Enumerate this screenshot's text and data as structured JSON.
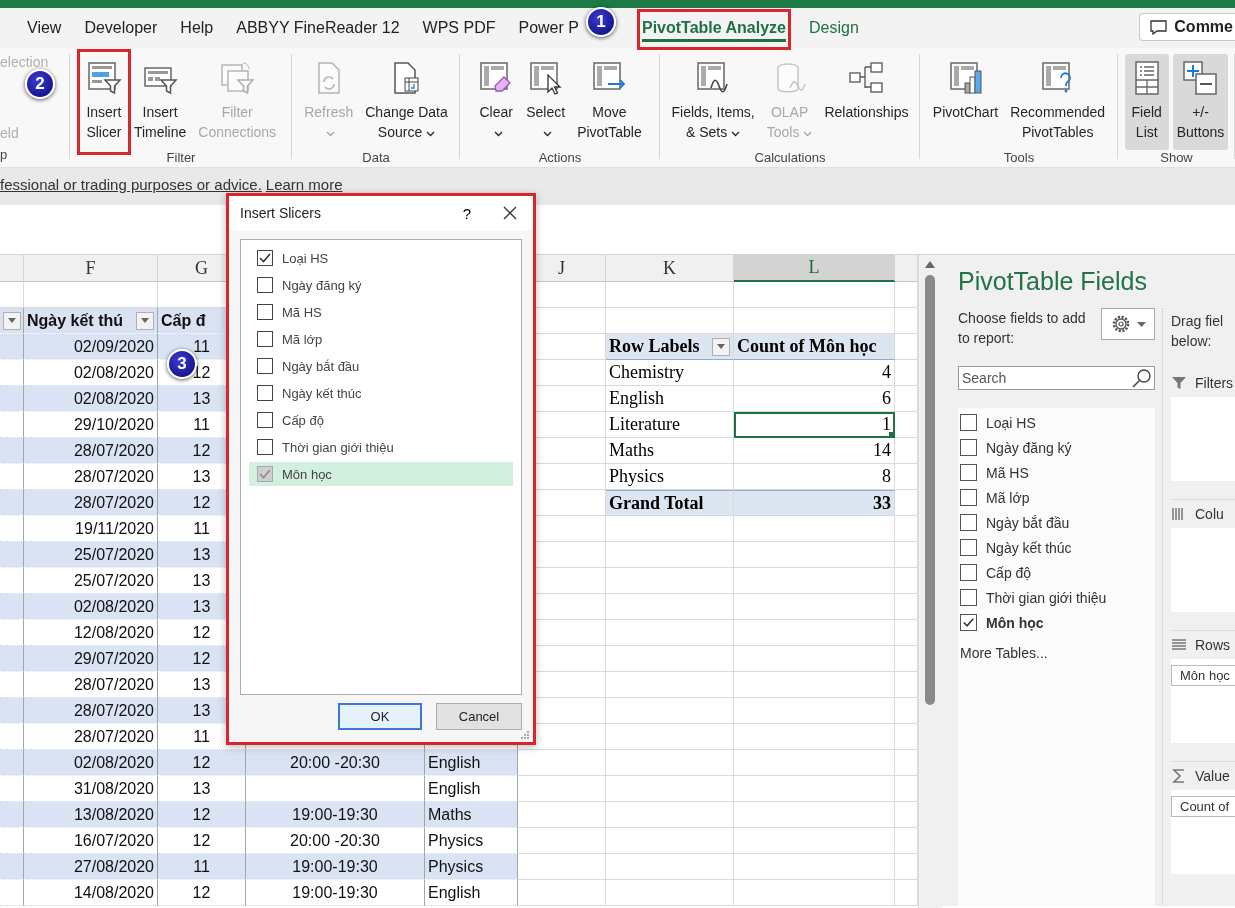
{
  "tabs": [
    {
      "label": "View",
      "selected": false,
      "contextual": false,
      "highlighted": false
    },
    {
      "label": "Developer",
      "selected": false,
      "contextual": false,
      "highlighted": false
    },
    {
      "label": "Help",
      "selected": false,
      "contextual": false,
      "highlighted": false
    },
    {
      "label": "ABBYY FineReader 12",
      "selected": false,
      "contextual": false,
      "highlighted": false
    },
    {
      "label": "WPS PDF",
      "selected": false,
      "contextual": false,
      "highlighted": false
    },
    {
      "label": "Power P",
      "selected": false,
      "contextual": false,
      "highlighted": false
    },
    {
      "label": "PivotTable Analyze",
      "selected": true,
      "contextual": true,
      "highlighted": true
    },
    {
      "label": "Design",
      "selected": false,
      "contextual": true,
      "highlighted": false
    }
  ],
  "comments_button": "Comme",
  "ribbon_groups": [
    {
      "label": "p",
      "buttons": [
        {
          "kind": "stub",
          "label": "election",
          "disabled": true
        },
        {
          "kind": "stub",
          "label": "eld",
          "disabled": true
        }
      ]
    },
    {
      "label": "Filter",
      "buttons": [
        {
          "kind": "slicer",
          "label": "Insert\nSlicer",
          "disabled": false,
          "dropdown": false,
          "pressed": false,
          "highlighted": true
        },
        {
          "kind": "timeline",
          "label": "Insert\nTimeline",
          "disabled": false,
          "dropdown": false,
          "pressed": false,
          "highlighted": false
        },
        {
          "kind": "connections",
          "label": "Filter\nConnections",
          "disabled": true,
          "dropdown": false,
          "pressed": false,
          "highlighted": false
        }
      ]
    },
    {
      "label": "Data",
      "buttons": [
        {
          "kind": "refresh",
          "label": "Refresh",
          "disabled": true,
          "dropdown": true,
          "pressed": false,
          "highlighted": false
        },
        {
          "kind": "datasource",
          "label": "Change Data\nSource",
          "disabled": false,
          "dropdown": true,
          "pressed": false,
          "highlighted": false
        }
      ]
    },
    {
      "label": "Actions",
      "buttons": [
        {
          "kind": "clear",
          "label": "Clear",
          "disabled": false,
          "dropdown": true,
          "pressed": false,
          "highlighted": false
        },
        {
          "kind": "select",
          "label": "Select",
          "disabled": false,
          "dropdown": true,
          "pressed": false,
          "highlighted": false
        },
        {
          "kind": "move",
          "label": "Move\nPivotTable",
          "disabled": false,
          "dropdown": false,
          "pressed": false,
          "highlighted": false
        }
      ]
    },
    {
      "label": "Calculations",
      "buttons": [
        {
          "kind": "fields",
          "label": "Fields, Items,\n& Sets",
          "disabled": false,
          "dropdown": true,
          "pressed": false,
          "highlighted": false
        },
        {
          "kind": "olap",
          "label": "OLAP\nTools",
          "disabled": true,
          "dropdown": true,
          "pressed": false,
          "highlighted": false
        },
        {
          "kind": "relationships",
          "label": "Relationships",
          "disabled": false,
          "dropdown": false,
          "pressed": false,
          "highlighted": false
        }
      ]
    },
    {
      "label": "Tools",
      "buttons": [
        {
          "kind": "pivotchart",
          "label": "PivotChart",
          "disabled": false,
          "dropdown": false,
          "pressed": false,
          "highlighted": false
        },
        {
          "kind": "recommended",
          "label": "Recommended\nPivotTables",
          "disabled": false,
          "dropdown": false,
          "pressed": false,
          "highlighted": false
        }
      ]
    },
    {
      "label": "Show",
      "buttons": [
        {
          "kind": "fieldlist",
          "label": "Field\nList",
          "disabled": false,
          "dropdown": false,
          "pressed": true,
          "highlighted": false
        },
        {
          "kind": "plusminus",
          "label": "+/-\nButtons",
          "disabled": false,
          "dropdown": false,
          "pressed": true,
          "highlighted": false
        }
      ]
    }
  ],
  "notice": {
    "text": "fessional or trading purposes or advice.",
    "link": "Learn more"
  },
  "column_headers": [
    {
      "label": "F",
      "selected": false
    },
    {
      "label": "G",
      "selected": false
    },
    {
      "label": "J",
      "selected": false
    },
    {
      "label": "K",
      "selected": false
    },
    {
      "label": "L",
      "selected": true
    }
  ],
  "table": {
    "cut_column_filter": true,
    "columns": [
      {
        "label": "Ngày kết thú",
        "filter": true
      },
      {
        "label": "Cấp đ",
        "filter": false
      }
    ],
    "rows": [
      {
        "end_date": "02/09/2020",
        "grade": "11"
      },
      {
        "end_date": "02/08/2020",
        "grade": "12"
      },
      {
        "end_date": "02/08/2020",
        "grade": "13"
      },
      {
        "end_date": "29/10/2020",
        "grade": "11"
      },
      {
        "end_date": "28/07/2020",
        "grade": "12"
      },
      {
        "end_date": "28/07/2020",
        "grade": "13"
      },
      {
        "end_date": "28/07/2020",
        "grade": "12"
      },
      {
        "end_date": "19/11/2020",
        "grade": "11"
      },
      {
        "end_date": "25/07/2020",
        "grade": "13"
      },
      {
        "end_date": "25/07/2020",
        "grade": "13"
      },
      {
        "end_date": "02/08/2020",
        "grade": "13"
      },
      {
        "end_date": "12/08/2020",
        "grade": "12"
      },
      {
        "end_date": "29/07/2020",
        "grade": "12"
      },
      {
        "end_date": "28/07/2020",
        "grade": "13"
      },
      {
        "end_date": "28/07/2020",
        "grade": "13"
      },
      {
        "end_date": "28/07/2020",
        "grade": "11"
      },
      {
        "end_date": "02/08/2020",
        "grade": "12",
        "time": "20:00 -20:30",
        "subject": "English"
      },
      {
        "end_date": "31/08/2020",
        "grade": "13",
        "subject": "English"
      },
      {
        "end_date": "13/08/2020",
        "grade": "12",
        "time": "19:00-19:30",
        "subject": "Maths"
      },
      {
        "end_date": "16/07/2020",
        "grade": "12",
        "time": "20:00 -20:30",
        "subject": "Physics"
      },
      {
        "end_date": "27/08/2020",
        "grade": "11",
        "time": "19:00-19:30",
        "subject": "Physics"
      },
      {
        "end_date": "14/08/2020",
        "grade": "12",
        "time": "19:00-19:30",
        "subject": "English"
      }
    ]
  },
  "pivot": {
    "row_labels": "Row Labels",
    "value_header": "Count of Môn học",
    "rows": [
      {
        "label": "Chemistry",
        "value": "4",
        "selected": false
      },
      {
        "label": "English",
        "value": "6",
        "selected": false
      },
      {
        "label": "Literature",
        "value": "1",
        "selected": true
      },
      {
        "label": "Maths",
        "value": "14",
        "selected": false
      },
      {
        "label": "Physics",
        "value": "8",
        "selected": false
      }
    ],
    "grand_total": {
      "label": "Grand Total",
      "value": "33"
    }
  },
  "field_pane": {
    "title": "PivotTable Fields",
    "choose_label": "Choose fields to add to report:",
    "search": {
      "placeholder": "Search"
    },
    "fields": [
      {
        "label": "Loại HS",
        "checked": false
      },
      {
        "label": "Ngày đăng ký",
        "checked": false
      },
      {
        "label": "Mã HS",
        "checked": false
      },
      {
        "label": "Mã lớp",
        "checked": false
      },
      {
        "label": "Ngày bắt đầu",
        "checked": false
      },
      {
        "label": "Ngày kết thúc",
        "checked": false
      },
      {
        "label": "Cấp độ",
        "checked": false
      },
      {
        "label": "Thời gian giới thiệu",
        "checked": false
      },
      {
        "label": "Môn học",
        "checked": true
      }
    ],
    "more_tables": "More Tables...",
    "drag_hint": "Drag fiel below:",
    "areas": [
      {
        "kind": "filters",
        "label": "Filters"
      },
      {
        "kind": "columns",
        "label": "Colu"
      },
      {
        "kind": "rows",
        "label": "Rows",
        "chip": "Môn học"
      },
      {
        "kind": "values",
        "label": "Value",
        "chip": "Count of"
      }
    ]
  },
  "dialog": {
    "title": "Insert Slicers",
    "help": "?",
    "highlighted": true,
    "fields": [
      {
        "label": "Loại HS",
        "checked": true,
        "disabled": false,
        "selected": false
      },
      {
        "label": "Ngày đăng ký",
        "checked": false,
        "disabled": false,
        "selected": false
      },
      {
        "label": "Mã HS",
        "checked": false,
        "disabled": false,
        "selected": false
      },
      {
        "label": "Mã lớp",
        "checked": false,
        "disabled": false,
        "selected": false
      },
      {
        "label": "Ngày bắt đầu",
        "checked": false,
        "disabled": false,
        "selected": false
      },
      {
        "label": "Ngày kết thúc",
        "checked": false,
        "disabled": false,
        "selected": false
      },
      {
        "label": "Cấp độ",
        "checked": false,
        "disabled": false,
        "selected": false
      },
      {
        "label": "Thời gian giới thiệu",
        "checked": false,
        "disabled": false,
        "selected": false
      },
      {
        "label": "Môn học",
        "checked": true,
        "disabled": true,
        "selected": true
      }
    ],
    "buttons": [
      {
        "label": "OK",
        "default": true
      },
      {
        "label": "Cancel",
        "default": false
      }
    ]
  },
  "badges": [
    "1",
    "2",
    "3"
  ]
}
